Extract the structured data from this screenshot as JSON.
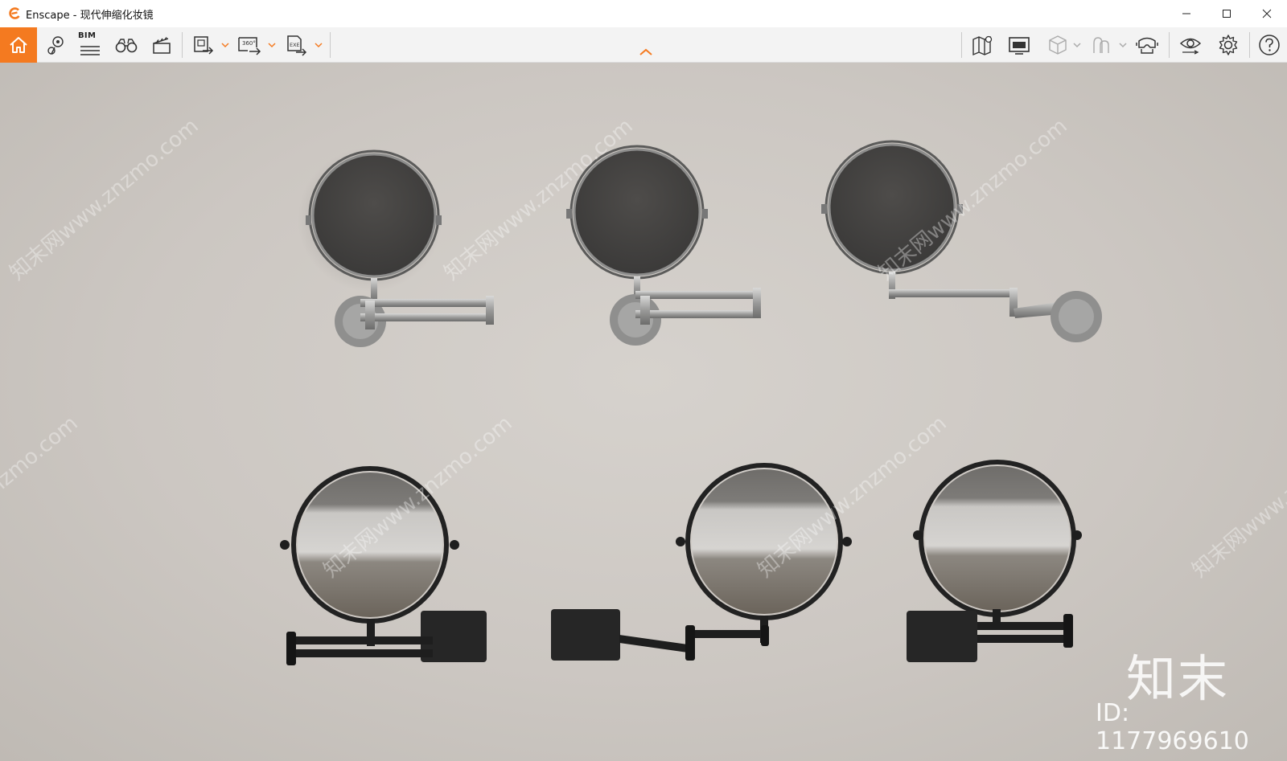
{
  "window": {
    "app_name": "Enscape",
    "separator": " - ",
    "document_title": "现代伸缩化妆镜"
  },
  "toolbar": {
    "bim_label": "BIM",
    "icons": [
      "home-icon",
      "location-pin-icon",
      "bim-list-icon",
      "binoculars-icon",
      "clapperboard-icon",
      "export-image-icon",
      "export-360-icon",
      "export-exe-icon",
      "map-icon",
      "screen-preview-icon",
      "cube-icon",
      "character-icon",
      "vr-headset-icon",
      "eye-icon",
      "settings-gear-icon",
      "help-icon"
    ],
    "accent_color": "#f47a20"
  },
  "viewport": {
    "watermark_text": "知末网www.znzmo.com",
    "brand_watermark": "知末",
    "id_watermark": "ID: 1177969610",
    "wall_color": "#cfcac5"
  }
}
